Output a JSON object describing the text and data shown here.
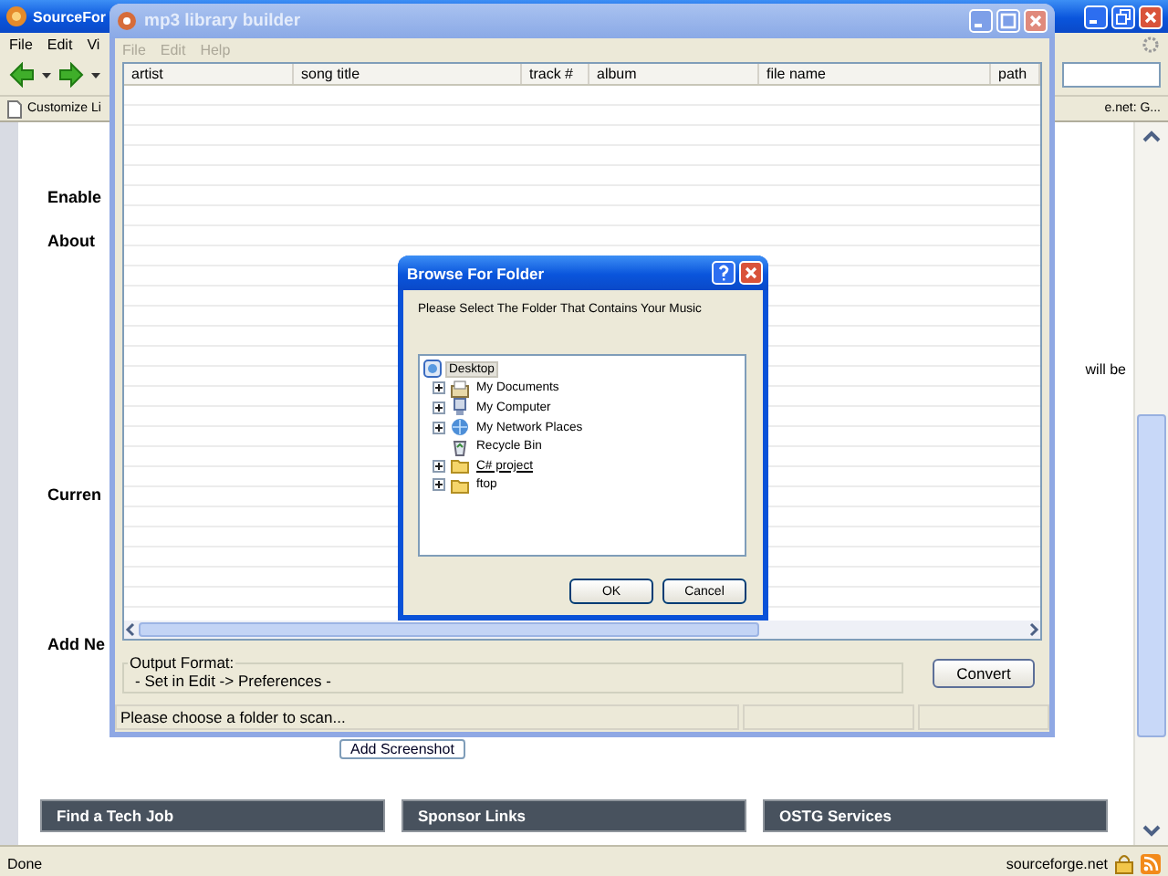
{
  "browser": {
    "title": "SourceFor",
    "menu": [
      "File",
      "Edit",
      "Vi"
    ],
    "bookmarks": [
      "Customize Li",
      "e.net: G..."
    ],
    "headings": [
      "Enable",
      "About",
      "Curren",
      "Add Ne"
    ],
    "text_fragment": "will be",
    "add_button": "Add Screenshot",
    "section_bars": [
      "Find a Tech Job",
      "Sponsor Links",
      "OSTG Services"
    ],
    "status_bar": {
      "text": "Done",
      "domain": "sourceforge.net"
    }
  },
  "app": {
    "title": "mp3 library builder",
    "menu": [
      {
        "label": "File",
        "disabled": true
      },
      {
        "label": "Edit",
        "disabled": true
      },
      {
        "label": "Help",
        "disabled": true
      }
    ],
    "columns": [
      "artist",
      "song title",
      "track #",
      "album",
      "file name",
      "path"
    ],
    "scroll": {
      "level": 0.7
    },
    "output_format": {
      "label": "Output Format:",
      "value": "- Set in Edit -> Preferences -"
    },
    "convert_button": "Convert",
    "status_bar": {
      "text": "Please choose a folder to scan..."
    }
  },
  "dialog": {
    "title": "Browse For Folder",
    "prompt": "Please Select The Folder That Contains Your Music",
    "tree": [
      {
        "label": "Desktop",
        "kind": "desktop",
        "selected": true,
        "hovered": false,
        "children": [
          {
            "label": "My Documents",
            "kind": "documents",
            "expandable": true,
            "selected": false,
            "hovered": false
          },
          {
            "label": "My Computer",
            "kind": "computer",
            "expandable": true,
            "selected": false,
            "hovered": false
          },
          {
            "label": "My Network Places",
            "kind": "network",
            "expandable": true,
            "selected": false,
            "hovered": false
          },
          {
            "label": "Recycle Bin",
            "kind": "recycle",
            "expandable": false,
            "selected": false,
            "hovered": false
          },
          {
            "label": "C# project",
            "kind": "folder",
            "expandable": true,
            "selected": false,
            "hovered": true
          },
          {
            "label": "ftop",
            "kind": "folder",
            "expandable": true,
            "selected": false,
            "hovered": false
          }
        ]
      }
    ],
    "buttons": [
      "OK",
      "Cancel"
    ]
  }
}
